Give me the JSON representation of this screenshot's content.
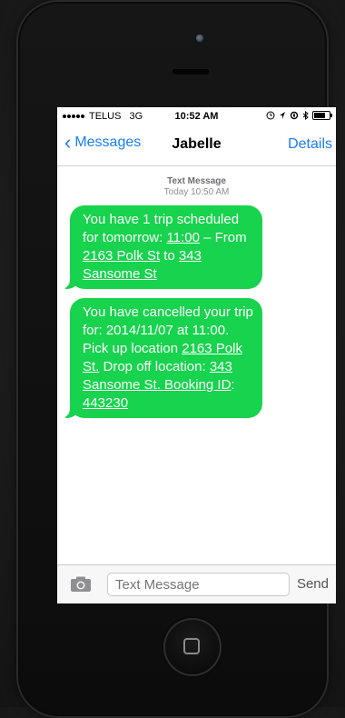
{
  "statusbar": {
    "carrier": "TELUS",
    "network": "3G",
    "time": "10:52 AM",
    "battery_level": 0.8
  },
  "navbar": {
    "back_label": "Messages",
    "title": "Jabelle",
    "details_label": "Details"
  },
  "meta": {
    "type": "Text Message",
    "timestamp": "Today 10:50 AM"
  },
  "messages": [
    {
      "parts": [
        {
          "text": "You have 1 trip scheduled for tomorrow: "
        },
        {
          "text": "11:00",
          "link": true
        },
        {
          "text": " – From "
        },
        {
          "text": "2163 Polk St",
          "link": true
        },
        {
          "text": " to "
        },
        {
          "text": "343 Sansome St",
          "link": true
        }
      ]
    },
    {
      "parts": [
        {
          "text": "You have cancelled your trip for: 2014/11/07 at 11:00. Pick up location "
        },
        {
          "text": "2163 Polk St.",
          "link": true
        },
        {
          "text": " Drop off location: "
        },
        {
          "text": "343 Sansome St. Booking ID",
          "link": true
        },
        {
          "text": ": "
        },
        {
          "text": "443230",
          "link": true
        }
      ]
    }
  ],
  "input": {
    "placeholder": "Text Message",
    "send_label": "Send"
  },
  "colors": {
    "bubble": "#17d34d",
    "accent": "#1a7cf5"
  }
}
